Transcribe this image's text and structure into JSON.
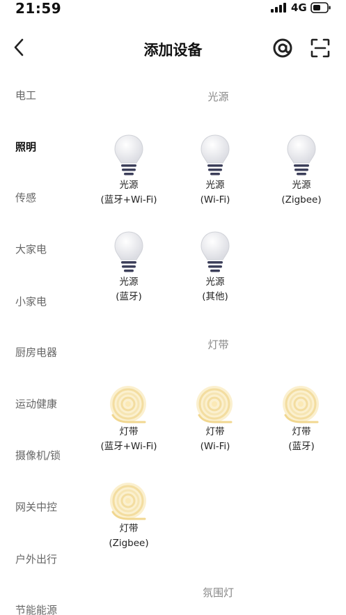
{
  "status_bar": {
    "time": "21:59",
    "network": "4G"
  },
  "nav": {
    "title": "添加设备"
  },
  "categories": [
    {
      "label": "电工",
      "active": false
    },
    {
      "label": "照明",
      "active": true
    },
    {
      "label": "传感",
      "active": false
    },
    {
      "label": "大家电",
      "active": false
    },
    {
      "label": "小家电",
      "active": false
    },
    {
      "label": "厨房电器",
      "active": false
    },
    {
      "label": "运动健康",
      "active": false
    },
    {
      "label": "摄像机/锁",
      "active": false
    },
    {
      "label": "网关中控",
      "active": false
    },
    {
      "label": "户外出行",
      "active": false
    },
    {
      "label": "节能能源",
      "active": false
    }
  ],
  "sections": [
    {
      "title": "光源",
      "devices": [
        {
          "name": "光源",
          "sub": "(蓝牙+Wi-Fi)",
          "icon": "light-bulb-icon"
        },
        {
          "name": "光源",
          "sub": "(Wi-Fi)",
          "icon": "light-bulb-icon"
        },
        {
          "name": "光源",
          "sub": "(Zigbee)",
          "icon": "light-bulb-icon"
        },
        {
          "name": "光源",
          "sub": "(蓝牙)",
          "icon": "light-bulb-icon"
        },
        {
          "name": "光源",
          "sub": "(其他)",
          "icon": "light-bulb-icon"
        }
      ]
    },
    {
      "title": "灯带",
      "devices": [
        {
          "name": "灯带",
          "sub": "(蓝牙+Wi-Fi)",
          "icon": "light-strip-icon"
        },
        {
          "name": "灯带",
          "sub": "(Wi-Fi)",
          "icon": "light-strip-icon"
        },
        {
          "name": "灯带",
          "sub": "(蓝牙)",
          "icon": "light-strip-icon"
        },
        {
          "name": "灯带",
          "sub": "(Zigbee)",
          "icon": "light-strip-icon"
        }
      ]
    },
    {
      "title": "氛围灯",
      "devices": []
    }
  ]
}
